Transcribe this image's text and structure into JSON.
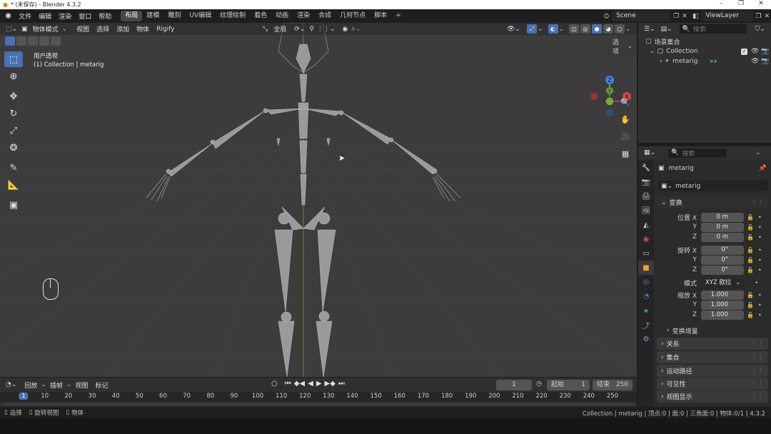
{
  "window": {
    "title": "* (未保存) - Blender 4.3.2",
    "controls": [
      "–",
      "❐",
      "✕"
    ]
  },
  "menus": [
    "文件",
    "编辑",
    "渲染",
    "窗口",
    "帮助"
  ],
  "workspaces": [
    {
      "label": "布局",
      "active": true
    },
    {
      "label": "建模"
    },
    {
      "label": "雕刻"
    },
    {
      "label": "UV编辑"
    },
    {
      "label": "纹理绘制"
    },
    {
      "label": "着色"
    },
    {
      "label": "动画"
    },
    {
      "label": "渲染"
    },
    {
      "label": "合成"
    },
    {
      "label": "几何节点"
    },
    {
      "label": "脚本"
    }
  ],
  "add_workspace": "+",
  "scene": "Scene",
  "view_layer": "ViewLayer",
  "viewport_header": {
    "mode": "物体模式",
    "menus": [
      "视图",
      "选择",
      "添加",
      "物体",
      "Rigify"
    ],
    "transform_orientation": "全局",
    "options": "选项"
  },
  "viewport_overlay": {
    "line1": "用户透视",
    "line2": "(1) Collection | metarig"
  },
  "gizmo": {
    "x": "X",
    "y": "Y",
    "z": "Z"
  },
  "outliner": {
    "search_placeholder": "搜索",
    "root": "场景集合",
    "collection": "Collection",
    "object": "metarig"
  },
  "properties": {
    "search_placeholder": "搜索",
    "object_name": "metarig",
    "object_field": "metarig",
    "transform_header": "变换",
    "location_label": "位置 X",
    "rotation_label": "旋转 X",
    "scale_label": "缩放 X",
    "axis_y": "Y",
    "axis_z": "Z",
    "location": [
      "0 m",
      "0 m",
      "0 m"
    ],
    "rotation": [
      "0°",
      "0°",
      "0°"
    ],
    "mode_label": "模式",
    "mode_value": "XYZ 欧拉",
    "scale": [
      "1.000",
      "1.000",
      "1.000"
    ],
    "delta": "变换增量",
    "sections": [
      "关系",
      "集合",
      "运动路径",
      "可见性",
      "视图显示"
    ]
  },
  "timeline": {
    "menus": [
      "回放",
      "插帧",
      "视图",
      "标记"
    ],
    "current_frame": "1",
    "start_label": "起始",
    "start": "1",
    "end_label": "结束",
    "end": "250",
    "ruler": [
      "1",
      "10",
      "20",
      "30",
      "40",
      "50",
      "60",
      "70",
      "80",
      "90",
      "100",
      "110",
      "120",
      "130",
      "140",
      "150",
      "160",
      "170",
      "180",
      "190",
      "200",
      "210",
      "220",
      "230",
      "240",
      "250"
    ]
  },
  "statusbar": {
    "select": "选择",
    "rotate": "旋转视图",
    "object": "物体",
    "right": "Collection | metarig | 顶点:0 | 面:0 | 三角面:0 | 物体:0/1 | 4.3.2"
  }
}
